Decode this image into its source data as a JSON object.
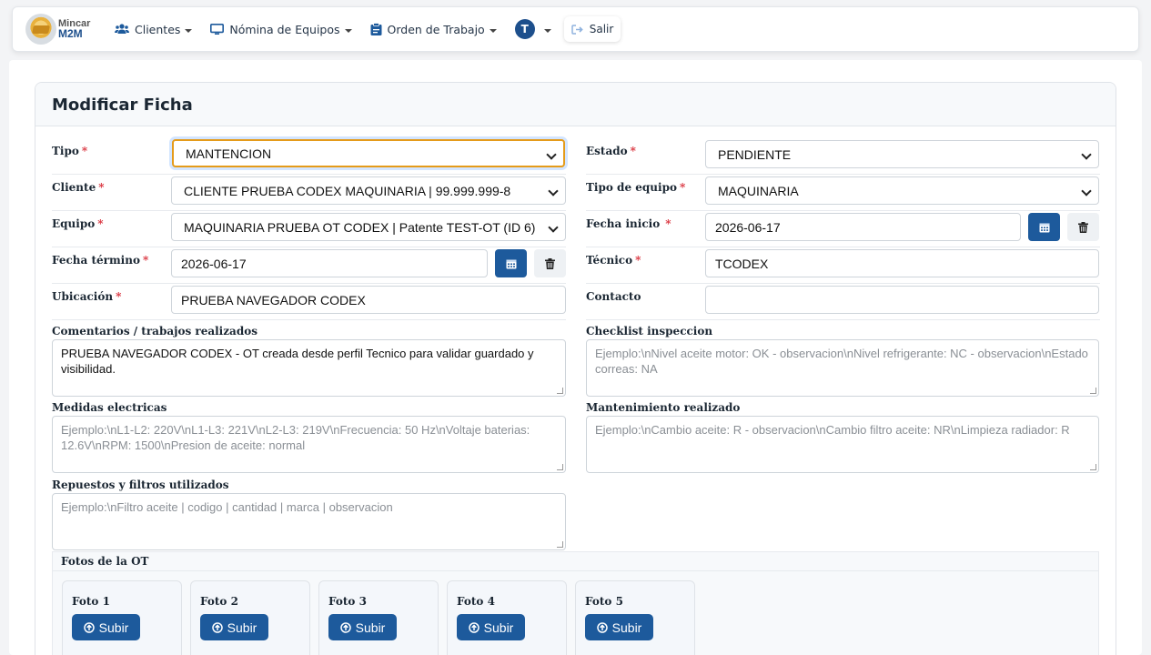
{
  "brand": {
    "line1": "Mincar",
    "line2": "M2M"
  },
  "nav": {
    "clients": "Clientes",
    "equipment": "Nómina de Equipos",
    "work_order": "Orden de Trabajo",
    "user_initial": "T",
    "logout": "Salir"
  },
  "page_title": "Modificar Ficha",
  "form": {
    "tipo": {
      "label": "Tipo",
      "value": "MANTENCION"
    },
    "estado": {
      "label": "Estado",
      "value": "PENDIENTE"
    },
    "cliente": {
      "label": "Cliente",
      "value": "CLIENTE PRUEBA CODEX MAQUINARIA | 99.999.999-8"
    },
    "tipo_equipo": {
      "label": "Tipo de equipo",
      "value": "MAQUINARIA"
    },
    "equipo": {
      "label": "Equipo",
      "value": "MAQUINARIA PRUEBA OT CODEX | Patente TEST-OT (ID 6)"
    },
    "fecha_inicio": {
      "label": "Fecha inicio",
      "value": "2026-06-17"
    },
    "fecha_termino": {
      "label": "Fecha término",
      "value": "2026-06-17"
    },
    "tecnico": {
      "label": "Técnico",
      "value": "TCODEX"
    },
    "ubicacion": {
      "label": "Ubicación",
      "value": "PRUEBA NAVEGADOR CODEX"
    },
    "contacto": {
      "label": "Contacto",
      "value": ""
    },
    "comentarios": {
      "label": "Comentarios / trabajos realizados",
      "value": "PRUEBA NAVEGADOR CODEX - OT creada desde perfil Tecnico para validar guardado y visibilidad."
    },
    "checklist": {
      "label": "Checklist inspeccion",
      "placeholder": "Ejemplo:\\nNivel aceite motor: OK - observacion\\nNivel refrigerante: NC - observacion\\nEstado correas: NA"
    },
    "medidas": {
      "label": "Medidas electricas",
      "placeholder": "Ejemplo:\\nL1-L2: 220V\\nL1-L3: 221V\\nL2-L3: 219V\\nFrecuencia: 50 Hz\\nVoltaje baterias: 12.6V\\nRPM: 1500\\nPresion de aceite: normal"
    },
    "mantenimiento": {
      "label": "Mantenimiento realizado",
      "placeholder": "Ejemplo:\\nCambio aceite: R - observacion\\nCambio filtro aceite: NR\\nLimpieza radiador: R"
    },
    "repuestos": {
      "label": "Repuestos y filtros utilizados",
      "placeholder": "Ejemplo:\\nFiltro aceite | codigo | cantidad | marca | observacion"
    }
  },
  "photos": {
    "title": "Fotos de la OT",
    "upload_label": "Subir",
    "items": [
      {
        "label": "Foto 1"
      },
      {
        "label": "Foto 2"
      },
      {
        "label": "Foto 3"
      },
      {
        "label": "Foto 4"
      },
      {
        "label": "Foto 5"
      }
    ]
  },
  "colors": {
    "primary": "#1d5a9c",
    "required": "#d9303b",
    "focus": "#e59b1a"
  }
}
